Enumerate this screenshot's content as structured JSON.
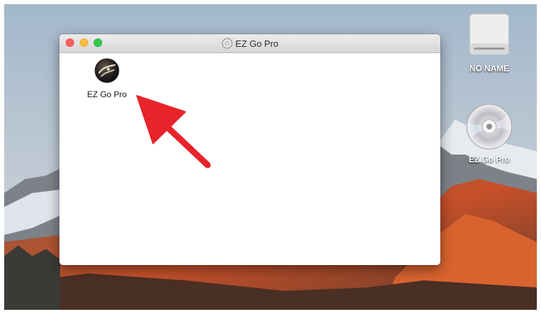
{
  "window": {
    "title": "EZ Go Pro",
    "title_icon": "disc-icon",
    "controls": [
      "close-button",
      "minimize-button",
      "zoom-button"
    ],
    "items": [
      {
        "label": "EZ Go Pro",
        "icon": "app-icon"
      }
    ]
  },
  "desktop": {
    "items": [
      {
        "label": "NO NAME",
        "icon": "drive-icon"
      },
      {
        "label": "EZ Go Pro",
        "icon": "disc-icon"
      }
    ]
  },
  "annotation": {
    "icon": "arrow-icon",
    "color": "#e8232a"
  },
  "colors": {
    "close": "#fc605c",
    "minimize": "#fdbc40",
    "zoom": "#34c84a"
  }
}
